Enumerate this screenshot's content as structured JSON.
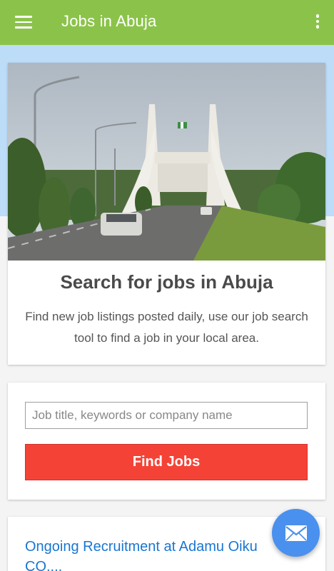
{
  "appbar": {
    "title": "Jobs in Abuja",
    "menu_icon": "hamburger-menu-icon",
    "overflow_icon": "more-vert-icon"
  },
  "hero": {
    "title": "Search for jobs in Abuja",
    "description": "Find new job listings posted daily, use our job search tool to find a job in your local area."
  },
  "search": {
    "placeholder": "Job title, keywords or company name",
    "value": "",
    "button_label": "Find Jobs"
  },
  "listings": [
    {
      "title": "Ongoing Recruitment at Adamu Oiku CO...."
    }
  ],
  "fab": {
    "icon": "envelope-icon"
  },
  "colors": {
    "appbar": "#8bc34a",
    "button": "#f44336",
    "link": "#1976d2",
    "fab": "#4a90ee",
    "sky": "#bcdcf7"
  }
}
